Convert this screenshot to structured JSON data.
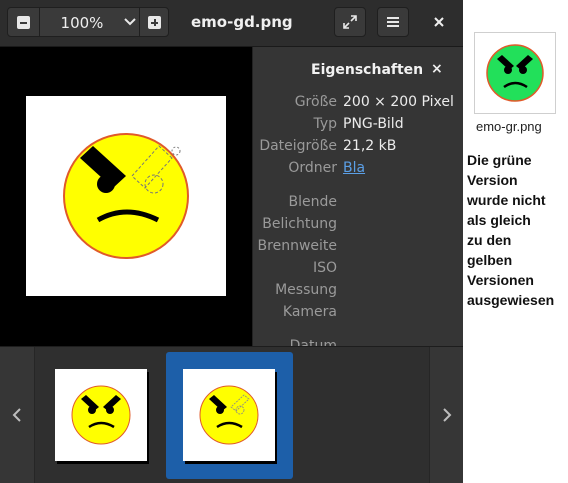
{
  "window": {
    "title": "emo-gd.png",
    "zoom_label": "100%",
    "accent_color": "#1d5fa9"
  },
  "toolbar": {
    "zoom_out_icon": "minus-icon",
    "zoom_menu_icon": "chevron-down-icon",
    "zoom_in_icon": "plus-icon",
    "fullscreen_icon": "fullscreen-icon",
    "menu_icon": "hamburger-icon",
    "close_icon": "close-icon"
  },
  "properties": {
    "title": "Eigenschaften",
    "close_label": "×",
    "rows": [
      {
        "key": "Größe",
        "value": "200 × 200 Pixel"
      },
      {
        "key": "Typ",
        "value": "PNG-Bild"
      },
      {
        "key": "Dateigröße",
        "value": "21,2 kB"
      },
      {
        "key": "Ordner",
        "value": "Bla"
      },
      {
        "key": "Blende",
        "value": ""
      },
      {
        "key": "Belichtung",
        "value": ""
      },
      {
        "key": "Brennweite",
        "value": ""
      },
      {
        "key": "ISO",
        "value": ""
      },
      {
        "key": "Messung",
        "value": ""
      },
      {
        "key": "Kamera",
        "value": ""
      },
      {
        "key": "Datum",
        "value": ""
      }
    ]
  },
  "gallery": {
    "prev_icon": "chevron-left-icon",
    "next_icon": "chevron-right-icon",
    "selected_index": 1
  },
  "desktop": {
    "file_name": "emo-gr.png",
    "note_lines": [
      "Die grüne",
      "Version",
      "wurde nicht",
      "als gleich",
      "zu den",
      "gelben",
      "Versionen",
      "ausgewiesen"
    ],
    "face_color_green": "#22e05a",
    "face_color_yellow": "#ffff00"
  }
}
